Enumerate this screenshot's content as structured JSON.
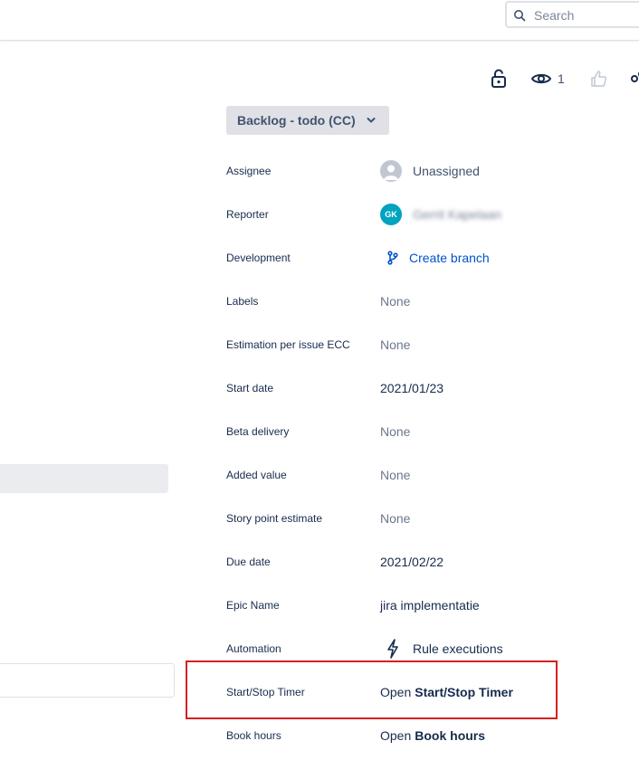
{
  "header": {
    "search_placeholder": "Search"
  },
  "actions": {
    "lock_icon": "unlock-icon",
    "watch_icon": "eye-icon",
    "watch_count": "1",
    "vote_icon": "thumbs-up-icon",
    "share_icon": "share-icon"
  },
  "status": {
    "label": "Backlog - todo (CC)"
  },
  "fields": {
    "assignee": {
      "label": "Assignee",
      "value": "Unassigned"
    },
    "reporter": {
      "label": "Reporter",
      "initials": "GK",
      "value": "Gerrit Kapelaan"
    },
    "development": {
      "label": "Development",
      "value": "Create branch"
    },
    "labels": {
      "label": "Labels",
      "value": "None"
    },
    "estimation": {
      "label": "Estimation per issue ECC",
      "value": "None"
    },
    "start_date": {
      "label": "Start date",
      "value": "2021/01/23"
    },
    "beta_delivery": {
      "label": "Beta delivery",
      "value": "None"
    },
    "added_value": {
      "label": "Added value",
      "value": "None"
    },
    "story_point": {
      "label": "Story point estimate",
      "value": "None"
    },
    "due_date": {
      "label": "Due date",
      "value": "2021/02/22"
    },
    "epic_name": {
      "label": "Epic Name",
      "value": "jira implementatie"
    },
    "automation": {
      "label": "Automation",
      "value": "Rule executions"
    },
    "timer": {
      "label": "Start/Stop Timer",
      "prefix": "Open",
      "value": "Start/Stop Timer"
    },
    "book_hours": {
      "label": "Book hours",
      "prefix": "Open",
      "value": "Book hours"
    }
  },
  "colors": {
    "link": "#0052cc",
    "highlight": "#d61f1f",
    "avatar": "#00a3bf"
  }
}
